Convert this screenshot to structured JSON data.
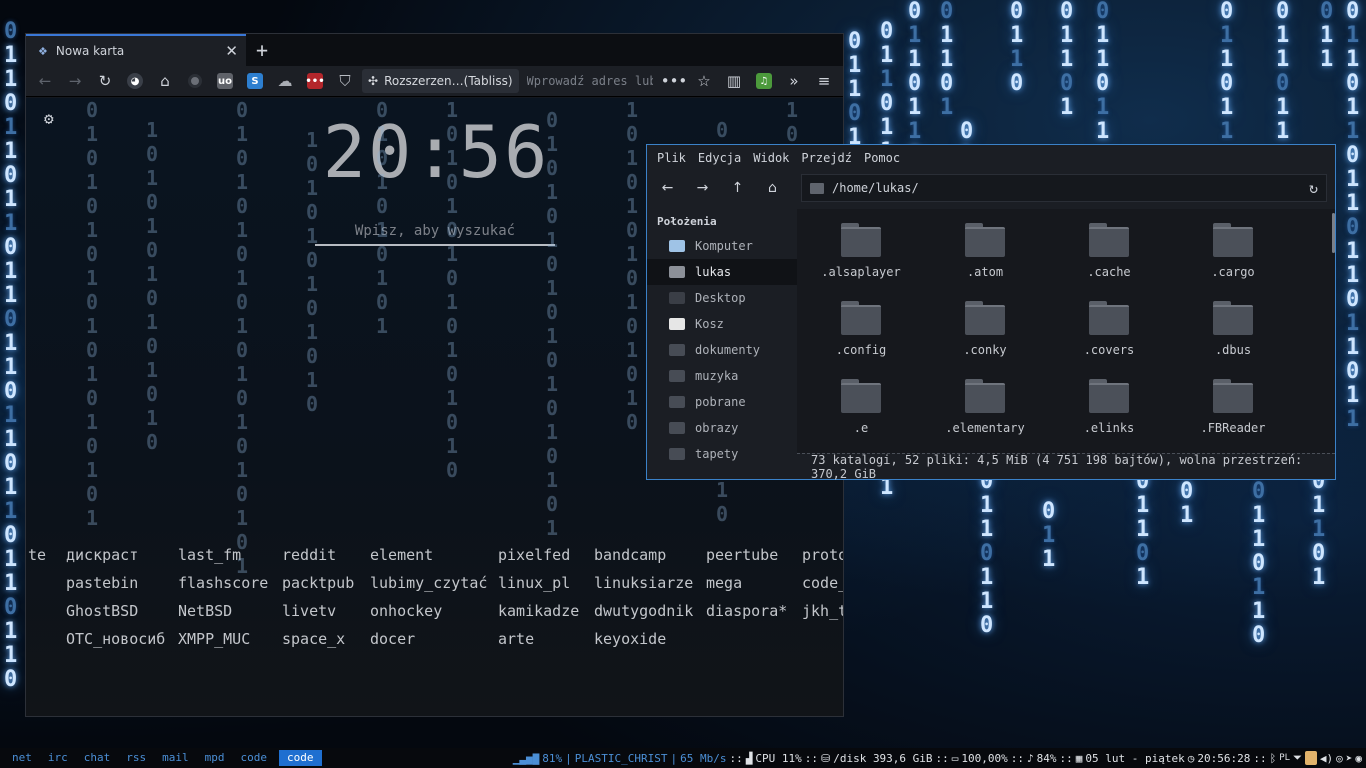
{
  "browser": {
    "tab_title": "Nowa karta",
    "extension_label": "Rozszerzen…(Tabliss)",
    "url_placeholder": "Wprowadź adres lub szuka",
    "page_actions": "•••",
    "overflow_label": "»",
    "menu_label": "≡"
  },
  "newtab": {
    "clock": "20:56",
    "search_placeholder": "Wpisz, aby wyszukać",
    "links": [
      "te",
      "дискраст",
      "last_fm",
      "reddit",
      "element",
      "pixelfed",
      "bandcamp",
      "peertube",
      "proto",
      "pastebin",
      "flashscore",
      "packtpub",
      "lubimy_czytać",
      "linux_pl",
      "linuksiarze",
      "mega",
      "code_",
      "GhostBSD",
      "NetBSD",
      "livetv",
      "onhockey",
      "kamikadze",
      "dwutygodnik",
      "diaspora*",
      "jkh_t",
      "OTC_новосиб",
      "XMPP_MUC",
      "space_x",
      "docer",
      "arte",
      "keyoxide"
    ]
  },
  "file_manager": {
    "menu": [
      "Plik",
      "Edycja",
      "Widok",
      "Przejdź",
      "Pomoc"
    ],
    "path": "/home/lukas/",
    "sidebar_heading": "Położenia",
    "places": [
      "Komputer",
      "lukas",
      "Desktop",
      "Kosz",
      "dokumenty",
      "muzyka",
      "pobrane",
      "obrazy",
      "tapety"
    ],
    "selected_place": "lukas",
    "files": [
      ".alsaplayer",
      ".atom",
      ".cache",
      ".cargo",
      ".config",
      ".conky",
      ".covers",
      ".dbus",
      ".e",
      ".elementary",
      ".elinks",
      ".FBReader"
    ],
    "status": "73 katalogi, 52 pliki: 4,5 MiB (4 751 198 bajtów), wolna przestrzeń: 370,2 GiB"
  },
  "panel": {
    "workspaces": [
      "net",
      "irc",
      "chat",
      "rss",
      "mail",
      "mpd",
      "code",
      "code"
    ],
    "active_workspace": 7,
    "volume_mpd": "81%",
    "track": "PLASTIC_CHRIST",
    "bitrate": "65 Mb/s",
    "cpu": "CPU 11%",
    "disk": "/disk 393,6 GiB",
    "battery": "100,00%",
    "volume": "84%",
    "date": "05 lut - piątek",
    "time": "20:56:28",
    "keyboard_layout": "PL",
    "separator": "::"
  },
  "colors": {
    "accent": "#3b82c9",
    "workspace_active": "#1f6fd0",
    "workspace_text": "#4b8fd6"
  }
}
